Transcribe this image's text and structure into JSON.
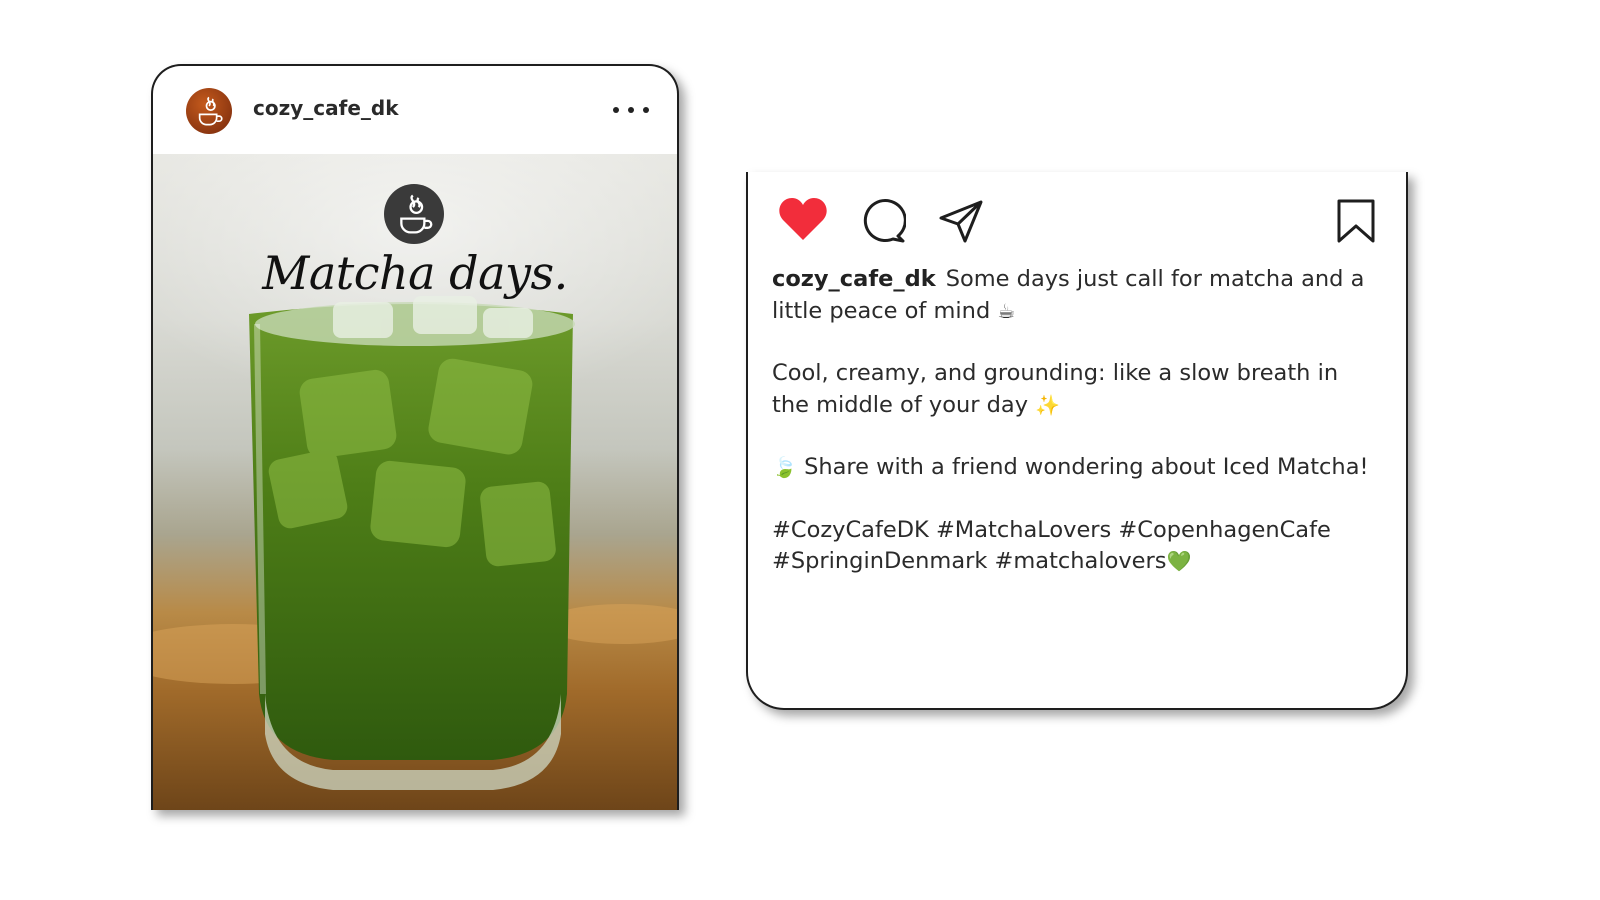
{
  "post": {
    "username": "cozy_cafe_dk",
    "image_title": "Matcha days."
  },
  "caption": {
    "username": "cozy_cafe_dk",
    "line1": "Some days just call for matcha and a little peace of mind",
    "line1_emoji": "☕",
    "line2": "Cool, creamy, and grounding: like a slow breath in the middle of your day",
    "line2_emoji": "✨",
    "line3_emoji": "🍃",
    "line3": "Share with a friend wondering about Iced Matcha!",
    "hashtags": "#CozyCafeDK #MatchaLovers #CopenhagenCafe #SpringinDenmark #matchalovers",
    "hashtags_emoji": "💚"
  },
  "icons": {
    "like": "heart-icon",
    "comment": "comment-icon",
    "share": "share-icon",
    "save": "bookmark-icon",
    "more": "more-options-icon"
  },
  "colors": {
    "like_red": "#f22d3b",
    "avatar_brown": "#a8441a",
    "matcha_green": "#4b7d18"
  }
}
